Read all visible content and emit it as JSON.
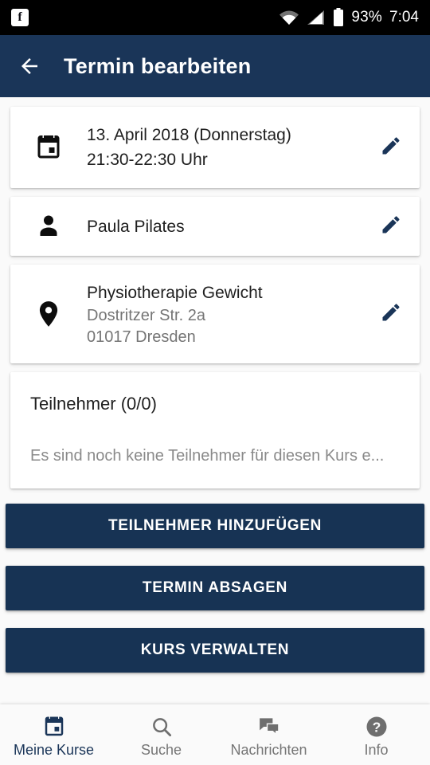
{
  "statusbar": {
    "notification_icon": "facebook-icon",
    "facebook_glyph": "f",
    "wifi_icon": "wifi-icon",
    "signal_icon": "cellular-signal-icon",
    "battery_icon": "battery-icon",
    "battery_percent": "93%",
    "time": "7:04"
  },
  "appbar": {
    "back_icon": "back-arrow-icon",
    "title": "Termin bearbeiten",
    "background": "#1a3558"
  },
  "cards": {
    "date": {
      "icon": "calendar-icon",
      "line1": "13. April 2018 (Donnerstag)",
      "line2": "21:30-22:30 Uhr",
      "edit_icon": "pencil-icon"
    },
    "person": {
      "icon": "person-icon",
      "line1": "Paula Pilates",
      "edit_icon": "pencil-icon"
    },
    "place": {
      "icon": "location-pin-icon",
      "line1": "Physiotherapie Gewicht",
      "line2": "Dostritzer Str. 2a",
      "line3": "01017 Dresden",
      "edit_icon": "pencil-icon"
    },
    "participants": {
      "title": "Teilnehmer (0/0)",
      "empty_text": "Es sind noch keine Teilnehmer für diesen Kurs e..."
    }
  },
  "actions": {
    "add_participant": "TEILNEHMER HINZUFÜGEN",
    "cancel_appointment": "TERMIN ABSAGEN",
    "manage_course": "KURS VERWALTEN",
    "button_color": "#173354"
  },
  "bottomnav": {
    "active_color": "#1a3558",
    "inactive_color": "#757575",
    "items": [
      {
        "icon": "calendar-icon",
        "label": "Meine Kurse",
        "active": true
      },
      {
        "icon": "search-icon",
        "label": "Suche",
        "active": false
      },
      {
        "icon": "chat-bubbles-icon",
        "label": "Nachrichten",
        "active": false
      },
      {
        "icon": "help-circle-icon",
        "label": "Info",
        "active": false
      }
    ]
  }
}
